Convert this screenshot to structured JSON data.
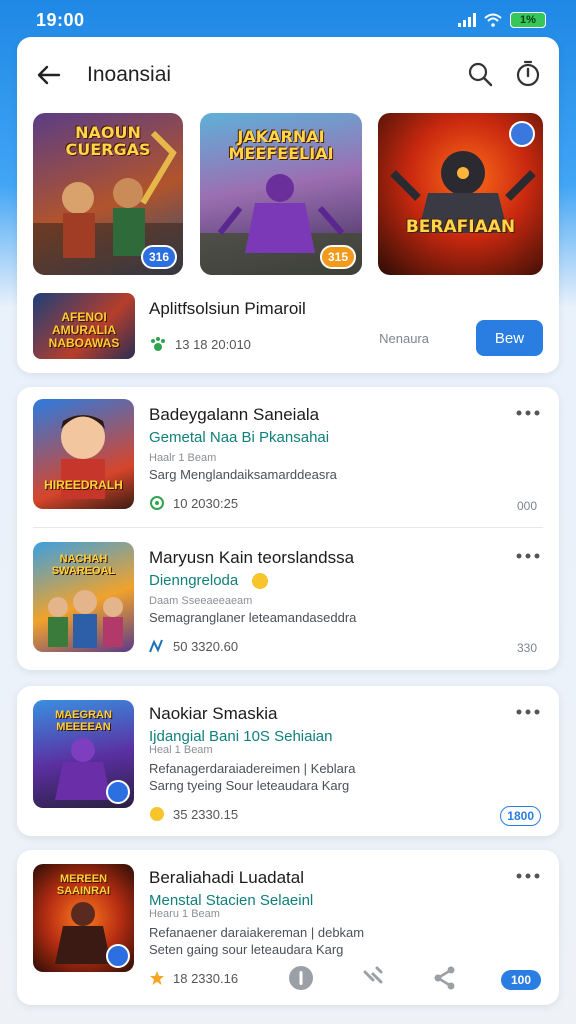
{
  "status": {
    "time": "19:00",
    "battery": "1%"
  },
  "header": {
    "title": "Inoansiai"
  },
  "banners": [
    {
      "art_text": "NAOUN CUERGAS",
      "badge": "316"
    },
    {
      "art_text": "JAKARNAI MEEFEELIAI",
      "badge": "315"
    },
    {
      "art_text": "BERAFIAAN"
    }
  ],
  "featured": {
    "thumb_text": "AFENOI AMURALIA NABOAWAS",
    "title": "Aplitfsolsiun Pimaroil",
    "meta": "13 18 20:010",
    "right_label": "Nenaura",
    "button_label": "Bew"
  },
  "items": [
    {
      "thumb_text": "HIREEDRALH",
      "title": "Badeygalann Saneiala",
      "subtitle": "Gemetal Naa Bi Pkansahai",
      "developer": "Haalr 1 Beam",
      "desc": "Sarg Menglandaiksamarddeasra",
      "meta": "10 2030:25",
      "extra": "000"
    },
    {
      "thumb_text": "NACHAH SWAREOAL",
      "title": "Maryusn Kain teorslandssa",
      "subtitle": "Dienngreloda",
      "developer": "Daam Sseeaeeaeam",
      "desc": "Semagranglaner leteamandaseddra",
      "meta": "50 3320.60",
      "extra": "330"
    },
    {
      "thumb_text": "MAEGRAN MEEEEAN",
      "title": "Naokiar Smaskia",
      "subtitle": "Ijdangial Bani 10S Sehiaian",
      "developer": "Heal 1 Beam",
      "desc": "Refanagerdaraiadereimen | Keblara",
      "desc2": "Sarng tyeing Sour leteaudara Karg",
      "meta": "35 2330.15",
      "pill": "1800"
    },
    {
      "thumb_text": "MEREEN SAAINRAI",
      "title": "Beraliahadi Luadatal",
      "subtitle": "Menstal Stacien Selaeinl",
      "developer": "Hearu 1 Beam",
      "desc": "Refanaener daraiakereman | debkam",
      "desc2": "Seten gaing sour leteaudara Karg",
      "meta": "18 2330.16",
      "pill": "100"
    }
  ],
  "colors": {
    "accent": "#2a7de1",
    "teal": "#0f7f7a",
    "badge_orange": "#f39a1a"
  }
}
